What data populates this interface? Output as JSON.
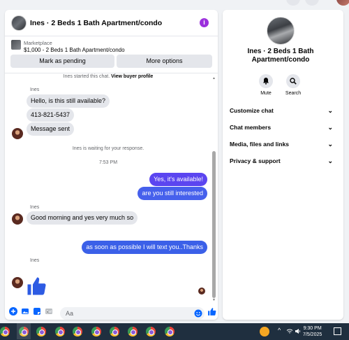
{
  "chat": {
    "title": "Ines · 2 Beds 1 Bath Apartment/condo",
    "info_icon": "i",
    "marketplace_label": "Marketplace",
    "listing": "$1,000 - 2 Beds 1 Bath Apartment/condo",
    "btn_pending": "Mark as pending",
    "btn_more": "More options",
    "system_started": "Ines started this chat.",
    "view_buyer": "View buyer profile",
    "sender_name": "Ines",
    "msg1": "Hello, is this still available?",
    "msg2": "413-821-5437",
    "msg3": "Message sent",
    "system_waiting": "Ines is waiting for your response.",
    "time1": "7:53 PM",
    "out1": "Yes, it's available!",
    "out2": "are you still interested",
    "msg4": "Good morning and yes very much so",
    "out3": "as soon as possible I will text you..Thanks",
    "composer_placeholder": "Aa"
  },
  "info": {
    "name": "Ines · 2 Beds 1 Bath Apartment/condo",
    "mute": "Mute",
    "search": "Search",
    "rows": [
      "Customize chat",
      "Chat members",
      "Media, files and links",
      "Privacy & support"
    ]
  },
  "taskbar": {
    "time": "9:30 PM",
    "date": "7/5/2025"
  },
  "colors": {
    "outgoing_1": "#5b45f0",
    "outgoing_2": "#4660ec",
    "outgoing_3": "#3b60e8",
    "accent_blue": "#0866ff",
    "info_purple": "#9b2fdc",
    "taskbar": "#1f2f3f"
  },
  "icons": [
    "info-icon",
    "bell-icon",
    "search-icon",
    "chevron-down-icon",
    "plus-icon",
    "photo-icon",
    "sticker-icon",
    "gif-icon",
    "emoji-icon",
    "thumbs-up-icon",
    "wifi-icon",
    "volume-icon",
    "battery-icon",
    "notification-icon"
  ]
}
